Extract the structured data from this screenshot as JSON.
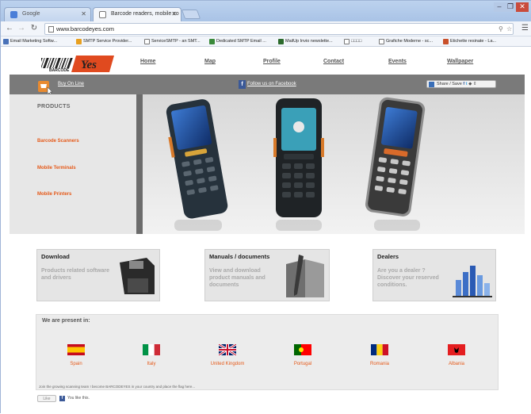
{
  "browser": {
    "tabs": [
      {
        "label": "Google",
        "active": false
      },
      {
        "label": "Barcode readers, mobile co",
        "active": true
      }
    ],
    "window_controls": [
      "–",
      "❐",
      "✕"
    ],
    "address": "www.barcodeyes.com",
    "bookmarks": [
      "Email Marketing Softw...",
      "SMTP Service Provider...",
      "ServiceSMTP - an SMT...",
      "Dedicated SMTP Email ...",
      "MailUp Invio newslette...",
      "□□□□",
      "Grafiche Moderne - sc...",
      "Etichette resinate - La..."
    ]
  },
  "site": {
    "logo_text": "BARCODE",
    "logo_brand": "Yes",
    "nav": [
      "Home",
      "Map",
      "Profile",
      "Contact",
      "Events",
      "Wallpaper"
    ],
    "buy_online": "Buy On Line",
    "facebook": "Follow us on Facebook",
    "share": "Share / Save",
    "sidebar": {
      "title": "PRODUCTS",
      "links": [
        "Barcode Scanners",
        "Mobile Terminals",
        "Mobile Printers"
      ]
    },
    "features": [
      {
        "title": "Download",
        "desc": "Products related software and drivers"
      },
      {
        "title": "Manuals / documents",
        "desc": "View and download product manuals and documents"
      },
      {
        "title": "Dealers",
        "desc": "Are you a dealer ? Discover your reserved conditions."
      }
    ],
    "present": {
      "title": "We are present in:",
      "countries": [
        "Spain",
        "Italy",
        "United Kingdom",
        "Portugal",
        "Romania",
        "Albania"
      ],
      "join": "Join the growing scanning team ! become BARCODEYES in your country and place the flag here..."
    },
    "like": {
      "button": "Like",
      "text": "You like this."
    }
  }
}
